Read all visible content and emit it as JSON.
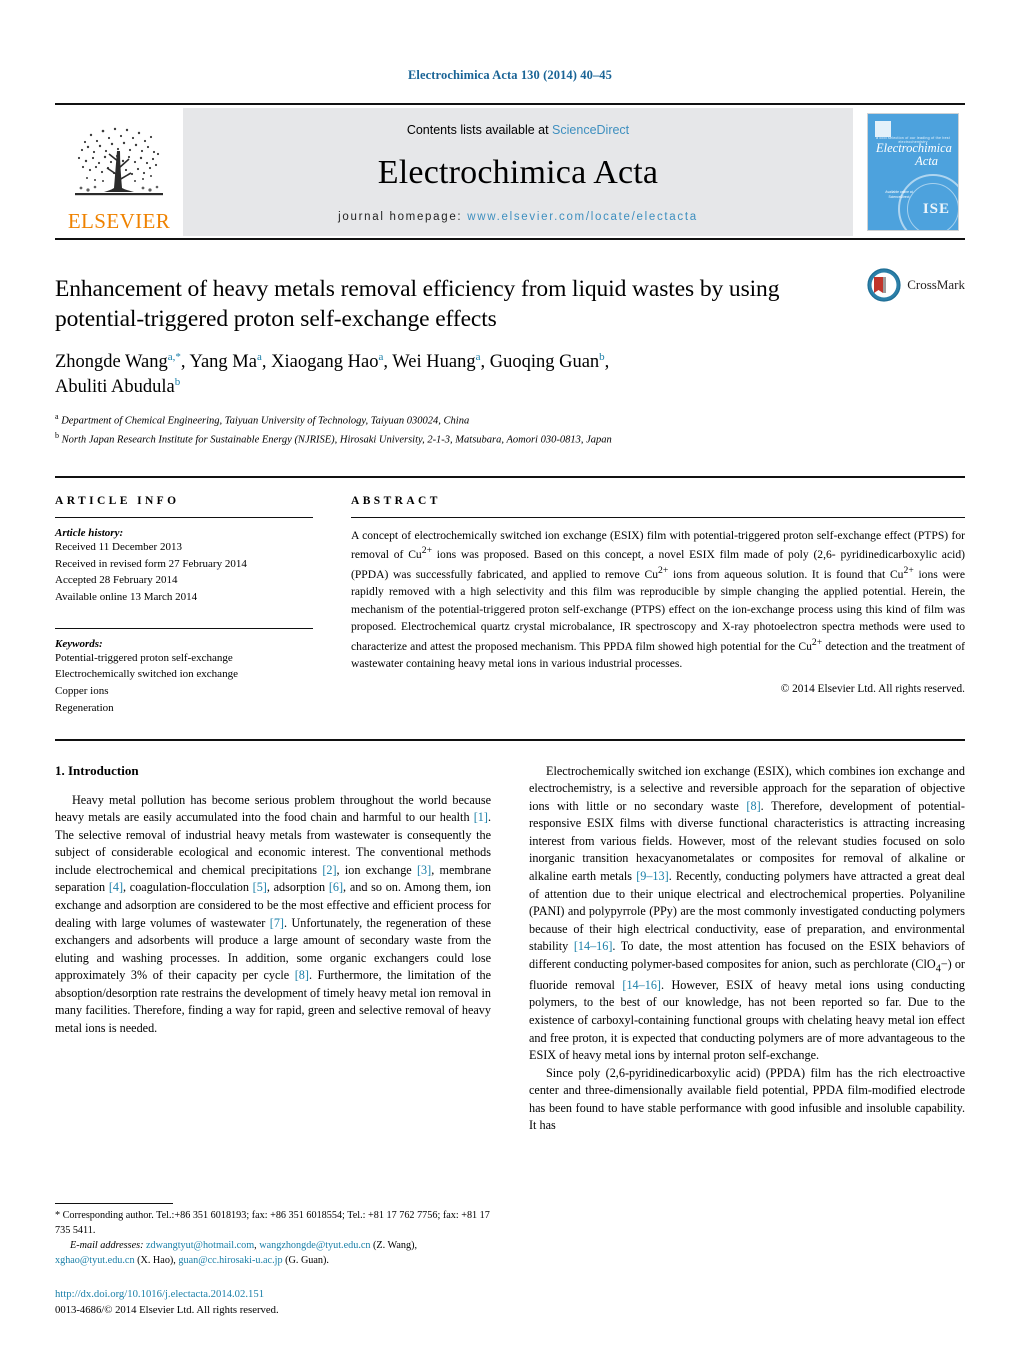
{
  "running_head": "Electrochimica Acta 130 (2014) 40–45",
  "masthead": {
    "publisher_wordmark": "ELSEVIER",
    "contents_prefix": "Contents lists available at ",
    "contents_link": "ScienceDirect",
    "journal_title": "Electrochimica Acta",
    "homepage_prefix": "journal homepage:",
    "homepage_url": "www.elsevier.com/locate/electacta",
    "cover": {
      "tagline": "a cool selection of our leading of the best electrochemistry",
      "title_line1": "Electrochimica",
      "title_line2": "Acta",
      "sciencedirect_note": "Available online at ScienceDirect",
      "seal_text": "ISE"
    }
  },
  "article": {
    "title": "Enhancement of heavy metals removal efficiency from liquid wastes by using potential-triggered proton self-exchange effects",
    "crossmark_label": "CrossMark",
    "authors": "Zhongde Wang, Yang Ma, Xiaogang Hao, Wei Huang, Guoqing Guan, Abuliti Abudula",
    "affiliation_a": "Department of Chemical Engineering, Taiyuan University of Technology, Taiyuan 030024, China",
    "affiliation_b": "North Japan Research Institute for Sustainable Energy (NJRISE), Hirosaki University, 2-1-3, Matsubara, Aomori 030-0813, Japan"
  },
  "article_info": {
    "kicker": "ARTICLE INFO",
    "history_label": "Article history:",
    "history": [
      "Received 11 December 2013",
      "Received in revised form 27 February 2014",
      "Accepted 28 February 2014",
      "Available online 13 March 2014"
    ],
    "keywords_label": "Keywords:",
    "keywords": [
      "Potential-triggered proton self-exchange",
      "Electrochemically switched ion exchange",
      "Copper ions",
      "Regeneration"
    ]
  },
  "abstract": {
    "kicker": "ABSTRACT",
    "text": "A concept of electrochemically switched ion exchange (ESIX) film with potential-triggered proton self-exchange effect (PTPS) for removal of Cu2+ ions was proposed. Based on this concept, a novel ESIX film made of poly (2,6- pyridinedicarboxylic acid) (PPDA) was successfully fabricated, and applied to remove Cu2+ ions from aqueous solution. It is found that Cu2+ ions were rapidly removed with a high selectivity and this film was reproducible by simple changing the applied potential. Herein, the mechanism of the potential-triggered proton self-exchange (PTPS) effect on the ion-exchange process using this kind of film was proposed. Electrochemical quartz crystal microbalance, IR spectroscopy and X-ray photoelectron spectra methods were used to characterize and attest the proposed mechanism. This PPDA film showed high potential for the Cu2+ detection and the treatment of wastewater containing heavy metal ions in various industrial processes.",
    "copyright": "© 2014 Elsevier Ltd. All rights reserved."
  },
  "introduction": {
    "heading": "1. Introduction",
    "left_para_1": "Heavy metal pollution has become serious problem throughout the world because heavy metals are easily accumulated into the food chain and harmful to our health [1]. The selective removal of industrial heavy metals from wastewater is consequently the subject of considerable ecological and economic interest. The conventional methods include electrochemical and chemical precipitations [2], ion exchange [3], membrane separation [4], coagulation-flocculation [5], adsorption [6], and so on. Among them, ion exchange and adsorption are considered to be the most effective and efficient process for dealing with large volumes of wastewater [7]. Unfortunately, the regeneration of these exchangers and adsorbents will produce a large amount of secondary waste from the eluting and washing processes. In addition, some organic exchangers could lose approximately 3% of their capacity per cycle [8]. Furthermore, the limitation of the absoption/desorption rate restrains the development of timely heavy metal ion removal in many facilities. Therefore, finding a way for rapid, green and selective removal of heavy metal ions is needed.",
    "right_para_1": "Electrochemically switched ion exchange (ESIX), which combines ion exchange and electrochemistry, is a selective and reversible approach for the separation of objective ions with little or no secondary waste [8]. Therefore, development of potential-responsive ESIX films with diverse functional characteristics is attracting increasing interest from various fields. However, most of the relevant studies focused on solo inorganic transition hexacyanometalates or composites for removal of alkaline or alkaline earth metals [9–13]. Recently, conducting polymers have attracted a great deal of attention due to their unique electrical and electrochemical properties. Polyaniline (PANI) and polypyrrole (PPy) are the most commonly investigated conducting polymers because of their high electrical conductivity, ease of preparation, and environmental stability [14–16]. To date, the most attention has focused on the ESIX behaviors of different conducting polymer-based composites for anion, such as perchlorate (ClO4−) or fluoride removal [14–16]. However, ESIX of heavy metal ions using conducting polymers, to the best of our knowledge, has not been reported so far. Due to the existence of carboxyl-containing functional groups with chelating heavy metal ion effect and free proton, it is expected that conducting polymers are of more advantageous to the ESIX of heavy metal ions by internal proton self-exchange.",
    "right_para_2": "Since poly (2,6-pyridinedicarboxylic acid) (PPDA) film has the rich electroactive center and three-dimensionally available field potential, PPDA film-modified electrode has been found to have stable performance with good infusible and insoluble capability. It has"
  },
  "footnotes": {
    "corresponding": "* Corresponding author. Tel.:+86 351 6018193; fax: +86 351 6018554; Tel.: +81 17 762 7756; fax: +81 17 735 5411.",
    "email_label": "E-mail addresses:",
    "emails": [
      {
        "address": "zdwangtyut@hotmail.com",
        "suffix": ","
      },
      {
        "address": "wangzhongde@tyut.edu.cn",
        "suffix": " (Z. Wang),"
      },
      {
        "address": "xghao@tyut.edu.cn",
        "suffix": " (X. Hao),"
      },
      {
        "address": "guan@cc.hirosaki-u.ac.jp",
        "suffix": " (G. Guan)."
      }
    ],
    "doi": "http://dx.doi.org/10.1016/j.electacta.2014.02.151",
    "issn_line": "0013-4686/© 2014 Elsevier Ltd. All rights reserved."
  },
  "colors": {
    "link_blue": "#1a7fa8",
    "header_blue": "#1a6496",
    "sciencedirect_blue": "#3e8fbf",
    "elsevier_orange": "#ef8200",
    "band_gray": "#e6e7e9",
    "cover_blue": "#4da2dd"
  }
}
